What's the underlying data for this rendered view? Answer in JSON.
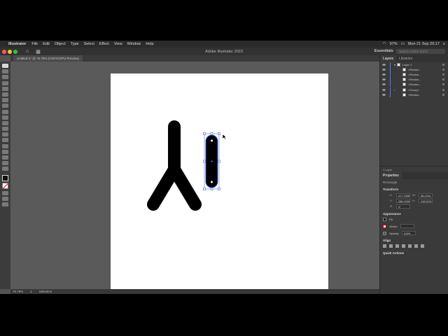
{
  "menubar": {
    "app_name": "Illustrator",
    "items": [
      "File",
      "Edit",
      "Object",
      "Type",
      "Select",
      "Effect",
      "View",
      "Window",
      "Help"
    ],
    "battery": "97%",
    "datetime": "Mon 21 Sep  20:17"
  },
  "appbar": {
    "title": "Adobe Illustrator 2023",
    "workspace": "Essentials",
    "search_placeholder": "Search Adobe Stock"
  },
  "document": {
    "tab_label": "Untitled-1* @ 76.78% (CMYK/GPU Preview)"
  },
  "statusbar": {
    "zoom": "76.78%",
    "artboard": "1",
    "tool": "Selection"
  },
  "layers_panel": {
    "tabs": [
      "Layers",
      "Libraries"
    ],
    "layer_name": "Layer 1",
    "items": [
      "<Rectan...",
      "<Rectan...",
      "<Rectan...",
      "<Rectan...",
      "<Group>",
      "<Rectan..."
    ],
    "footer": "1 Layer"
  },
  "properties_panel": {
    "tab": "Properties",
    "object_type": "Rectangle",
    "transform_label": "Transform",
    "x_label": "X:",
    "x_value": "277.7355",
    "y_label": "Y:",
    "y_value": "268.1335",
    "w_label": "W:",
    "w_value": "55.1764 (",
    "h_label": "H:",
    "h_value": "218.5221",
    "rotate_value": "0°",
    "appearance_label": "Appearance",
    "fill_label": "Fill",
    "stroke_label": "Stroke",
    "opacity_label": "Opacity",
    "opacity_value": "100%",
    "align_label": "Align",
    "quick_actions_label": "Quick Actions"
  },
  "colors": {
    "accent": "#4a77ff",
    "art_fill": "#000000",
    "selection": "#3f5bd6"
  }
}
